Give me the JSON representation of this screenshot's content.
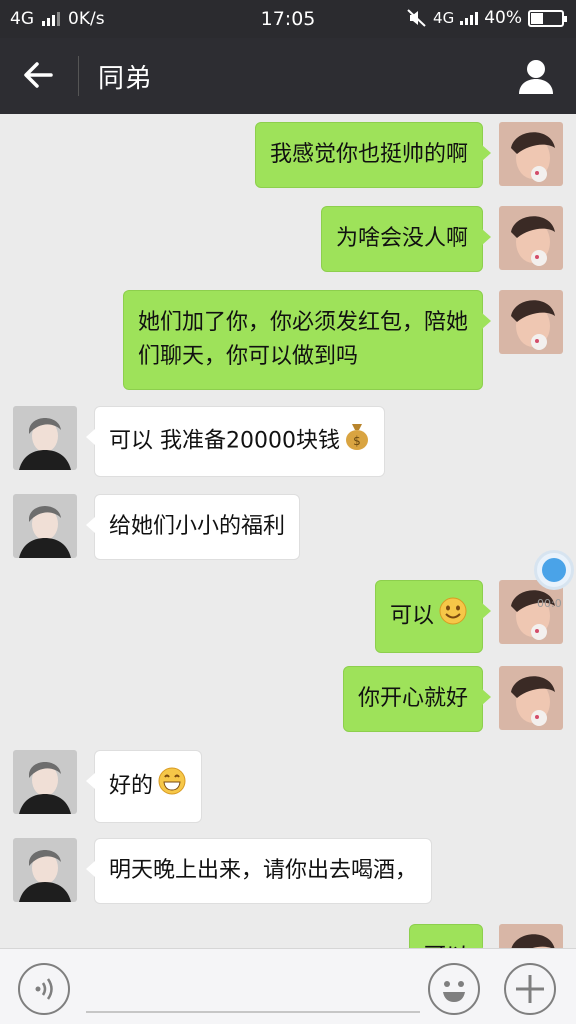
{
  "status_bar": {
    "network": "4G",
    "speed": "0K/s",
    "time": "17:05",
    "network_right": "4G",
    "battery": "40%",
    "battery_level": 0.4
  },
  "header": {
    "title": "同弟",
    "icons": {
      "back": "arrow-left-icon",
      "profile": "person-icon"
    }
  },
  "messages": [
    {
      "side": "right",
      "text": "我感觉你也挺帅的啊"
    },
    {
      "side": "right",
      "text": "为啥会没人啊"
    },
    {
      "side": "right",
      "line1": "她们加了你，你必须发红包，陪她",
      "line2": "们聊天，你可以做到吗"
    },
    {
      "side": "left",
      "text": "可以 我准备20000块钱",
      "emoji": "money-bag-emoji"
    },
    {
      "side": "left",
      "text": "给她们小小的福利"
    },
    {
      "side": "right",
      "text": "可以",
      "emoji": "smiling-face-emoji"
    },
    {
      "side": "right",
      "text": "你开心就好"
    },
    {
      "side": "left",
      "text": "好的",
      "emoji": "grinning-face-emoji"
    },
    {
      "side": "left",
      "text": "明天晚上出来，请你出去喝酒，"
    },
    {
      "side": "right",
      "text": "可以"
    }
  ],
  "floating_widget": {
    "label": "00:0"
  },
  "input_bar": {
    "icons": {
      "voice": "voice-icon",
      "emoji": "emoji-icon",
      "more": "plus-icon"
    }
  },
  "colors": {
    "sent_bubble": "#9ee25a",
    "received_bubble": "#ffffff",
    "header": "#2d2d32",
    "background": "#ebebeb"
  }
}
